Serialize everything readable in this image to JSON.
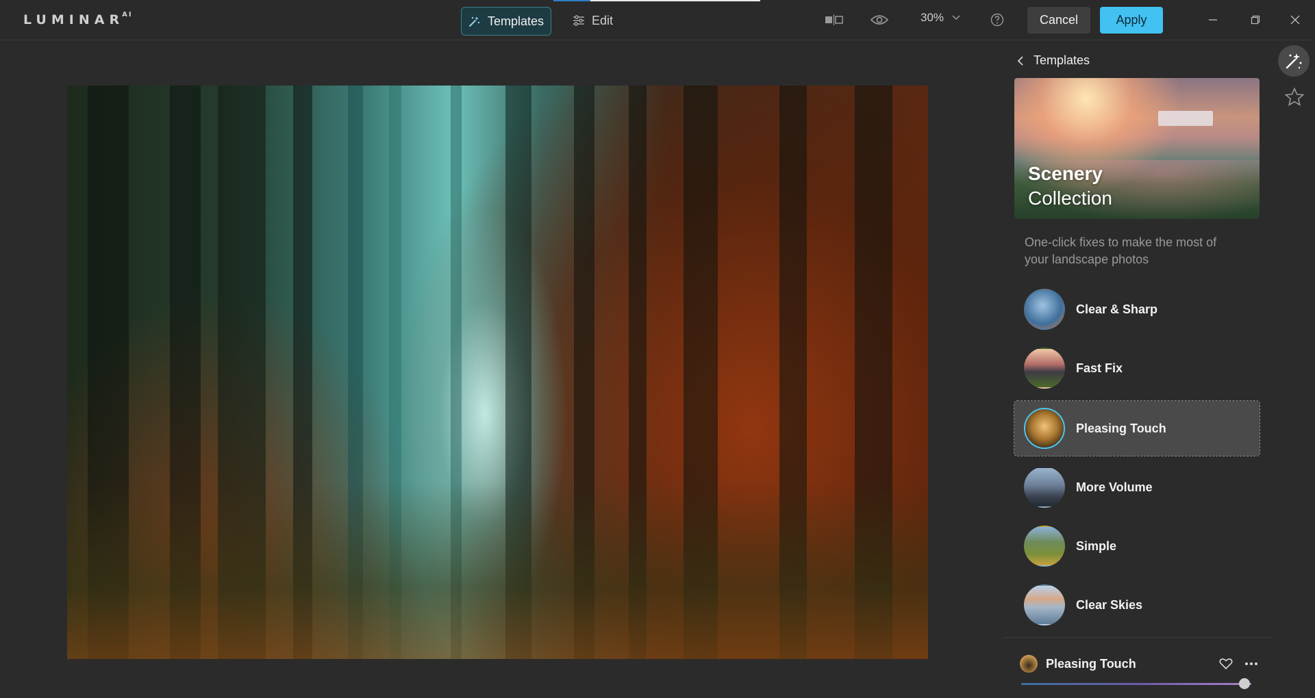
{
  "app": {
    "logo": "LUMINAR",
    "logo_sup": "AI",
    "loading_progress": 0.18
  },
  "header": {
    "tabs": [
      {
        "label": "Templates",
        "active": true,
        "icon": "magic-sparkle-icon"
      },
      {
        "label": "Edit",
        "active": false,
        "icon": "sliders-icon"
      }
    ],
    "zoom": "30%",
    "cancel_label": "Cancel",
    "apply_label": "Apply",
    "colors": {
      "accent": "#41c2f2",
      "tab_active_bg": "#1d3b43"
    }
  },
  "panel": {
    "back_label": "Templates",
    "collection": {
      "title_line1": "Scenery",
      "title_line2": "Collection",
      "description": "One-click fixes to make the most of your landscape photos"
    },
    "templates": [
      {
        "label": "Clear & Sharp",
        "selected": false
      },
      {
        "label": "Fast Fix",
        "selected": false
      },
      {
        "label": "Pleasing Touch",
        "selected": true
      },
      {
        "label": "More Volume",
        "selected": false
      },
      {
        "label": "Simple",
        "selected": false
      },
      {
        "label": "Clear Skies",
        "selected": false
      }
    ],
    "active_template": {
      "label": "Pleasing Touch",
      "amount": 0.97
    }
  }
}
